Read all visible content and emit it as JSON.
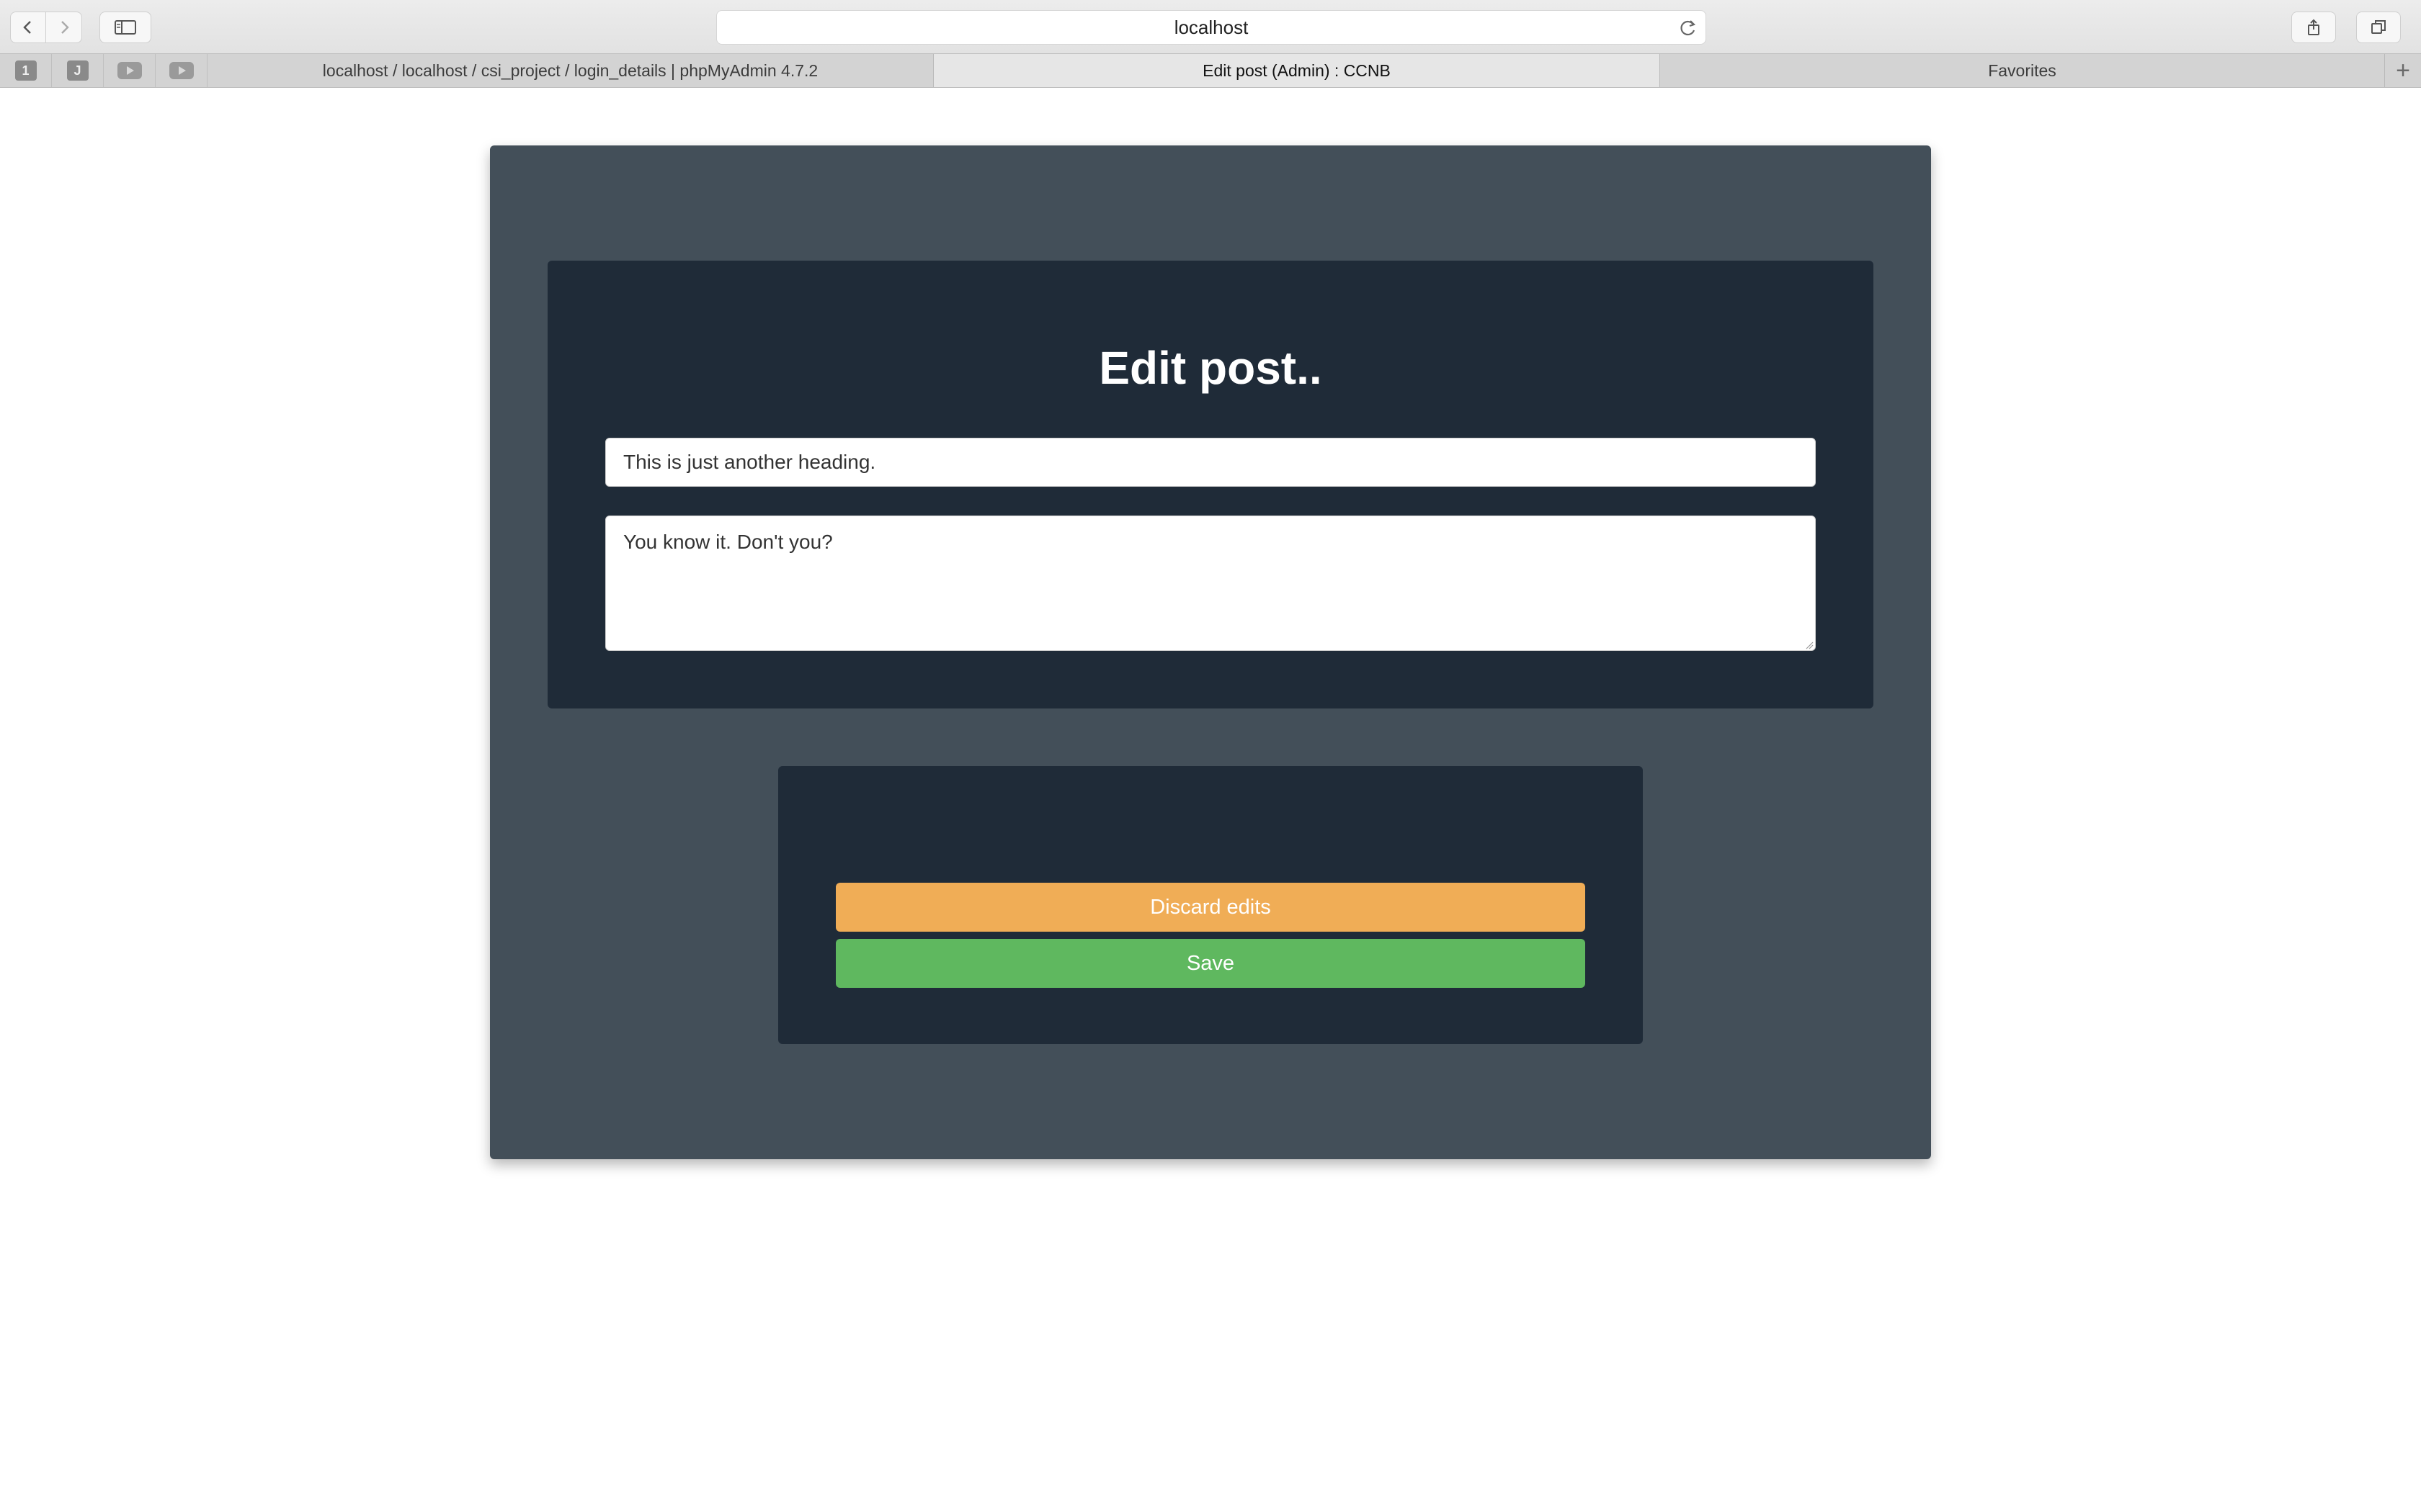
{
  "browser": {
    "address": "localhost",
    "pinned_tabs": [
      {
        "label": "1",
        "icon": "number-one-icon"
      },
      {
        "label": "J",
        "icon": "letter-j-icon"
      },
      {
        "label": "",
        "icon": "youtube-icon"
      },
      {
        "label": "",
        "icon": "youtube-icon"
      }
    ],
    "tabs": [
      {
        "title": "localhost / localhost / csi_project / login_details | phpMyAdmin 4.7.2",
        "active": false
      },
      {
        "title": "Edit post (Admin) : CCNB",
        "active": true
      },
      {
        "title": "Favorites",
        "active": false
      }
    ],
    "new_tab_label": "+"
  },
  "page": {
    "title": "Edit post..",
    "heading_value": "This is just another heading.",
    "body_value": "You know it. Don't you?",
    "discard_label": "Discard edits",
    "save_label": "Save"
  },
  "colors": {
    "outer_panel": "#434f59",
    "card": "#1f2b38",
    "discard": "#f0ad56",
    "save": "#5fb85f"
  }
}
